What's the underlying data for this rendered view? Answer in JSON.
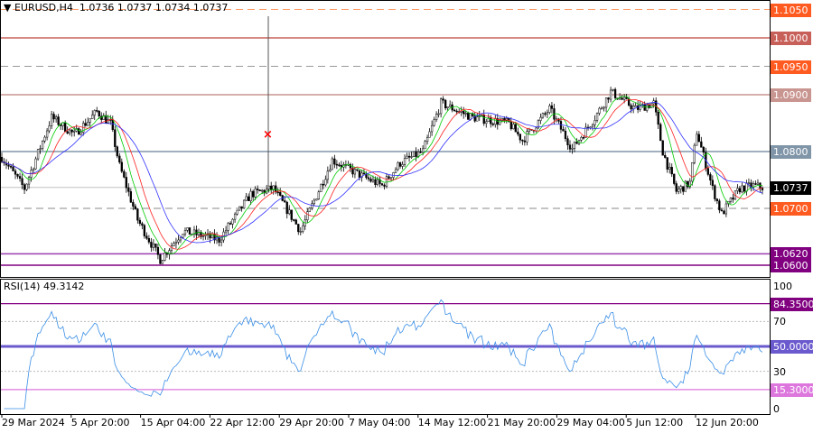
{
  "header": {
    "symbol_timeframe": "EURUSD,H4",
    "ohlc": "1.0736 1.0737 1.0734 1.0737"
  },
  "price_axis": {
    "ticks": [
      "1.0870",
      "1.0810",
      "1.0745",
      "1.0685",
      "1.0635"
    ],
    "levels": [
      {
        "value": 1.105,
        "label": "1.1050",
        "color": "#ff5a1f",
        "style": "dashed",
        "line": "#ff9a66"
      },
      {
        "value": 1.1,
        "label": "1.1000",
        "color": "#c8605a",
        "style": "solid",
        "line": "#c8605a"
      },
      {
        "value": 1.095,
        "label": "1.0950",
        "color": "#ff5a1f",
        "style": "dashed",
        "line": "#999999"
      },
      {
        "value": 1.09,
        "label": "1.0900",
        "color": "#c99590",
        "style": "solid",
        "line": "#c99590"
      },
      {
        "value": 1.08,
        "label": "1.0800",
        "color": "#8095a8",
        "style": "solid",
        "line": "#8095a8"
      },
      {
        "value": 1.07,
        "label": "1.0700",
        "color": "#ff5a1f",
        "style": "dashed",
        "line": "#888888"
      },
      {
        "value": 1.062,
        "label": "1.0620",
        "color": "#800080",
        "style": "solid",
        "line": "#9b3fb0"
      },
      {
        "value": 1.06,
        "label": "1.0600",
        "color": "#800080",
        "style": "solid",
        "line": "#800080"
      }
    ],
    "current": {
      "value": 1.0737,
      "label": "1.0737",
      "color": "#000000"
    }
  },
  "price_path": [
    [
      0,
      1.079
    ],
    [
      10,
      1.0735
    ],
    [
      22,
      1.086
    ],
    [
      32,
      1.083
    ],
    [
      42,
      1.087
    ],
    [
      48,
      1.085
    ],
    [
      52,
      1.0775
    ],
    [
      60,
      1.068
    ],
    [
      70,
      1.061
    ],
    [
      80,
      1.066
    ],
    [
      96,
      1.0645
    ],
    [
      110,
      1.0725
    ],
    [
      120,
      1.0735
    ],
    [
      132,
      1.066
    ],
    [
      146,
      1.0785
    ],
    [
      160,
      1.0755
    ],
    [
      168,
      1.074
    ],
    [
      176,
      1.078
    ],
    [
      186,
      1.08
    ],
    [
      194,
      1.0885
    ],
    [
      208,
      1.086
    ],
    [
      224,
      1.085
    ],
    [
      230,
      1.082
    ],
    [
      242,
      1.0875
    ],
    [
      252,
      1.0805
    ],
    [
      262,
      1.086
    ],
    [
      269,
      1.0905
    ],
    [
      280,
      1.0875
    ],
    [
      288,
      1.0885
    ],
    [
      292,
      1.08
    ],
    [
      298,
      1.073
    ],
    [
      304,
      1.0745
    ],
    [
      307,
      1.0835
    ],
    [
      314,
      1.0735
    ],
    [
      318,
      1.069
    ],
    [
      326,
      1.0735
    ],
    [
      332,
      1.074
    ],
    [
      336,
      1.0737
    ]
  ],
  "rsi": {
    "title": "RSI(14) 49.3142",
    "ticks": [
      "100",
      "70",
      "30",
      "0"
    ],
    "levels": [
      {
        "value": 84.35,
        "label": "84.3500",
        "color": "#800080"
      },
      {
        "value": 50,
        "label": "50.0000",
        "color": "#6a5acd"
      },
      {
        "value": 15.3,
        "label": "15.3000",
        "color": "#dd77dd"
      }
    ]
  },
  "time_axis": [
    "29 Mar 2024",
    "5 Apr 20:00",
    "15 Apr 04:00",
    "22 Apr 12:00",
    "29 Apr 20:00",
    "7 May 04:00",
    "14 May 12:00",
    "21 May 20:00",
    "29 May 04:00",
    "5 Jun 12:00",
    "12 Jun 20:00"
  ],
  "colors": {
    "ma_fast": "#00cc00",
    "ma_mid": "#ff2020",
    "ma_slow": "#3030ff",
    "rsi_line": "#3a8ee6",
    "marker": "#ff0000"
  }
}
